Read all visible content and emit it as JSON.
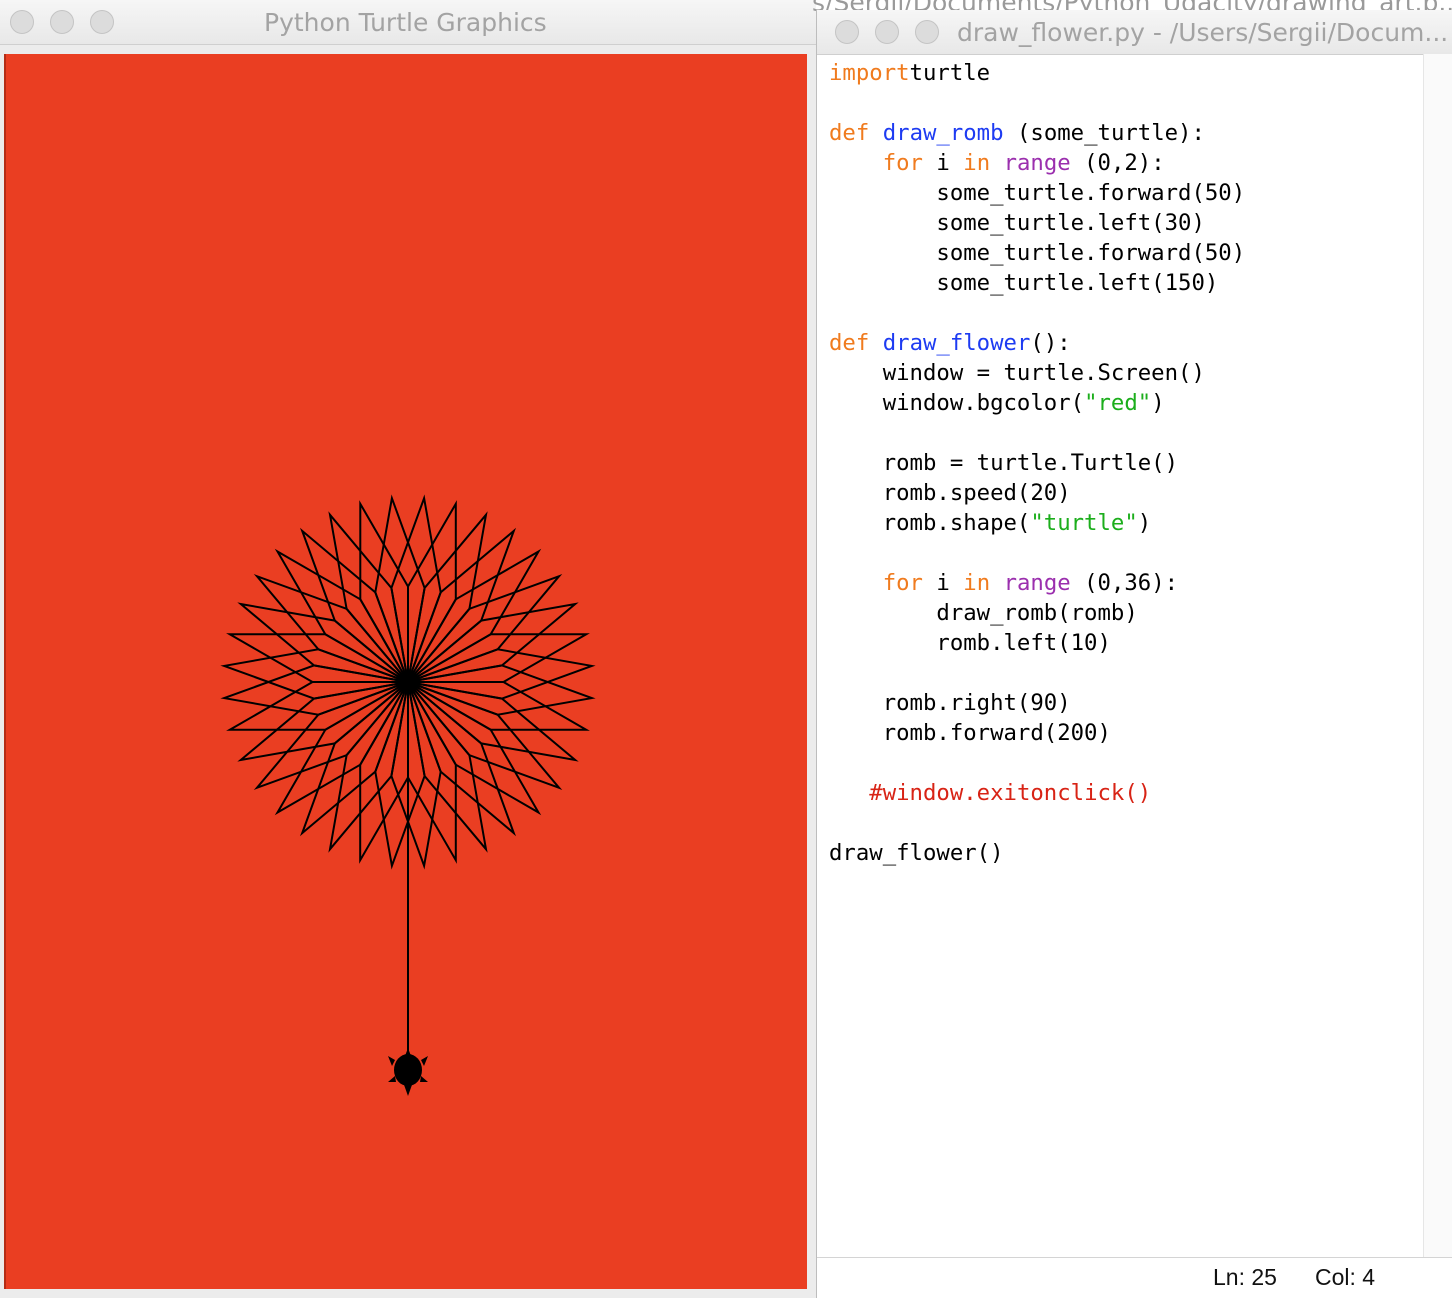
{
  "turtle_window": {
    "title": "Python Turtle Graphics",
    "background_color": "#ea3e22"
  },
  "background_window": {
    "title_fragment": "s/Sergii/Documents/Python_Udacity/drawing_art.p..."
  },
  "editor": {
    "title": "draw_flower.py - /Users/Sergii/Docum...",
    "code_lines": [
      [
        [
          "kw",
          "import"
        ],
        [
          "",
          "turtle"
        ]
      ],
      [],
      [
        [
          "kw",
          "def"
        ],
        [
          "",
          " "
        ],
        [
          "fn",
          "draw_romb"
        ],
        [
          "",
          " (some_turtle):"
        ]
      ],
      [
        [
          "",
          "    "
        ],
        [
          "kw",
          "for"
        ],
        [
          "",
          " i "
        ],
        [
          "kw",
          "in"
        ],
        [
          "",
          " "
        ],
        [
          "bi",
          "range"
        ],
        [
          "",
          " (0,2):"
        ]
      ],
      [
        [
          "",
          "        some_turtle.forward(50)"
        ]
      ],
      [
        [
          "",
          "        some_turtle.left(30)"
        ]
      ],
      [
        [
          "",
          "        some_turtle.forward(50)"
        ]
      ],
      [
        [
          "",
          "        some_turtle.left(150)"
        ]
      ],
      [],
      [
        [
          "kw",
          "def"
        ],
        [
          "",
          " "
        ],
        [
          "fn",
          "draw_flower"
        ],
        [
          "",
          "():"
        ]
      ],
      [
        [
          "",
          "    window = turtle.Screen()"
        ]
      ],
      [
        [
          "",
          "    window.bgcolor("
        ],
        [
          "str",
          "\"red\""
        ],
        [
          "",
          ")"
        ]
      ],
      [],
      [
        [
          "",
          "    romb = turtle.Turtle()"
        ]
      ],
      [
        [
          "",
          "    romb.speed(20)"
        ]
      ],
      [
        [
          "",
          "    romb.shape("
        ],
        [
          "str",
          "\"turtle\""
        ],
        [
          "",
          ")"
        ]
      ],
      [],
      [
        [
          "",
          "    "
        ],
        [
          "kw",
          "for"
        ],
        [
          "",
          " i "
        ],
        [
          "kw",
          "in"
        ],
        [
          "",
          " "
        ],
        [
          "bi",
          "range"
        ],
        [
          "",
          " (0,36):"
        ]
      ],
      [
        [
          "",
          "        draw_romb(romb)"
        ]
      ],
      [
        [
          "",
          "        romb.left(10)"
        ]
      ],
      [],
      [
        [
          "",
          "    romb.right(90)"
        ]
      ],
      [
        [
          "",
          "    romb.forward(200)"
        ]
      ],
      [],
      [
        [
          "",
          "   "
        ],
        [
          "cm",
          "#window.exitonclick()"
        ]
      ],
      [],
      [
        [
          "",
          "draw_flower()"
        ]
      ]
    ],
    "status": {
      "line": "Ln: 25",
      "col": "Col: 4"
    }
  },
  "drawing": {
    "rhombus_count": 36,
    "rhombus_side": 50,
    "turn_per_rhombus_deg": 10,
    "stem_length": 200,
    "stroke_color": "#000000"
  }
}
